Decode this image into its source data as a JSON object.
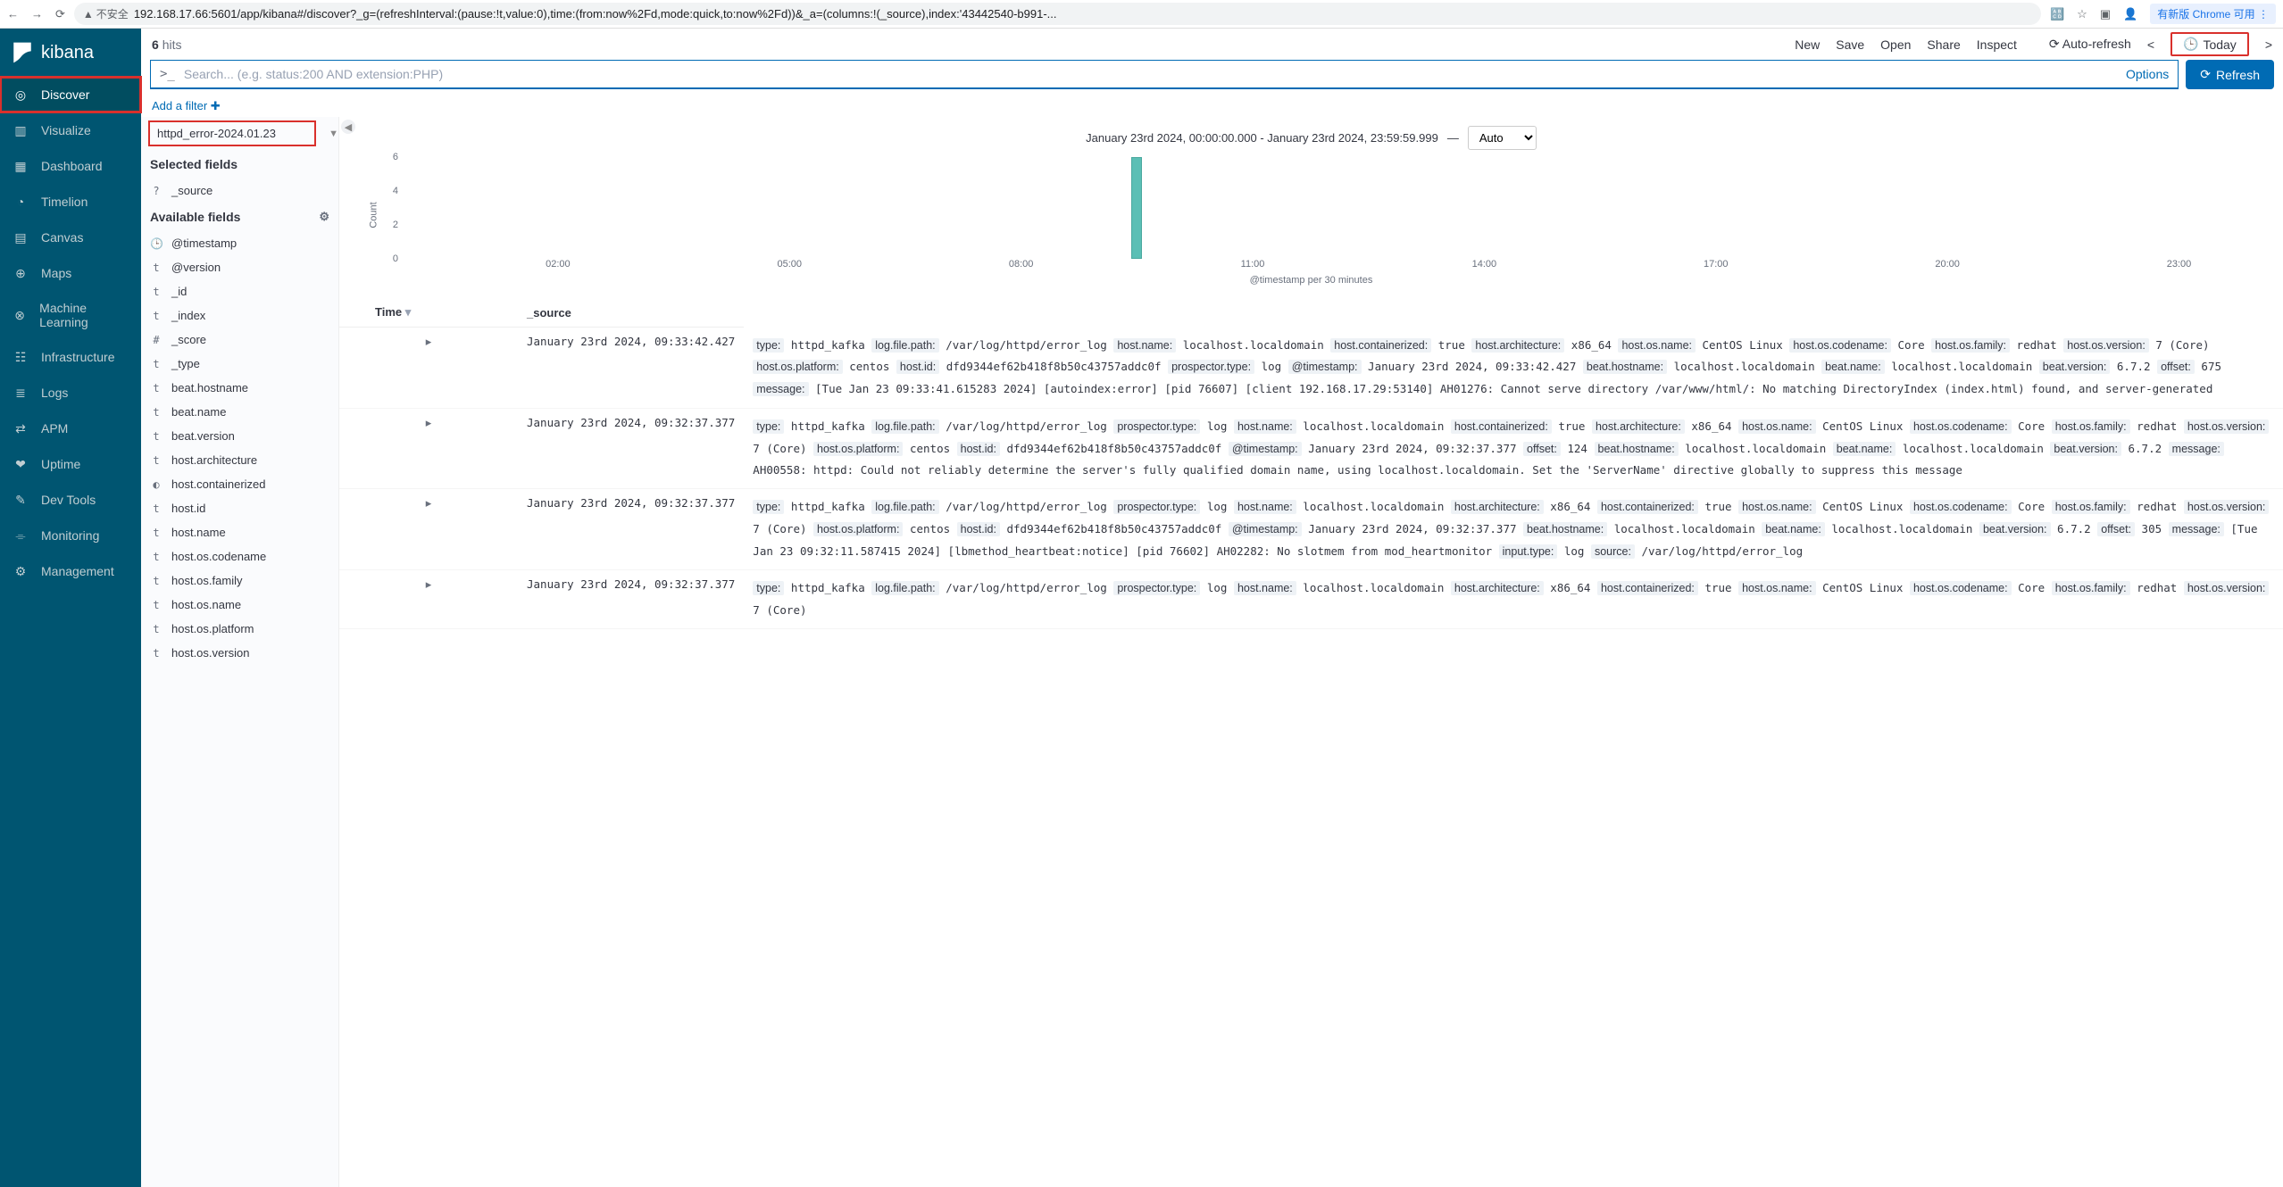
{
  "browser": {
    "secure_label": "不安全",
    "url": "192.168.17.66:5601/app/kibana#/discover?_g=(refreshInterval:(pause:!t,value:0),time:(from:now%2Fd,mode:quick,to:now%2Fd))&_a=(columns:!(_source),index:'43442540-b991-...",
    "update_badge": "有新版 Chrome 可用"
  },
  "logo": "kibana",
  "nav": [
    {
      "label": "Discover",
      "icon": "compass",
      "active": true,
      "highlight": true
    },
    {
      "label": "Visualize",
      "icon": "bars"
    },
    {
      "label": "Dashboard",
      "icon": "grid"
    },
    {
      "label": "Timelion",
      "icon": "timelion"
    },
    {
      "label": "Canvas",
      "icon": "canvas"
    },
    {
      "label": "Maps",
      "icon": "maps"
    },
    {
      "label": "Machine Learning",
      "icon": "ml"
    },
    {
      "label": "Infrastructure",
      "icon": "infra"
    },
    {
      "label": "Logs",
      "icon": "logs"
    },
    {
      "label": "APM",
      "icon": "apm"
    },
    {
      "label": "Uptime",
      "icon": "uptime"
    },
    {
      "label": "Dev Tools",
      "icon": "dev"
    },
    {
      "label": "Monitoring",
      "icon": "monitor"
    },
    {
      "label": "Management",
      "icon": "gear"
    }
  ],
  "hits_count": "6",
  "hits_label": "hits",
  "top_actions": [
    "New",
    "Save",
    "Open",
    "Share",
    "Inspect"
  ],
  "auto_refresh": "Auto-refresh",
  "time_picker": "Today",
  "search_placeholder": "Search... (e.g. status:200 AND extension:PHP)",
  "options_label": "Options",
  "refresh_label": "Refresh",
  "add_filter": "Add a filter",
  "index_pattern": "httpd_error-2024.01.23",
  "selected_fields_title": "Selected fields",
  "available_fields_title": "Available fields",
  "selected_fields": [
    {
      "type": "?",
      "name": "_source"
    }
  ],
  "available_fields": [
    {
      "type": "🕒",
      "name": "@timestamp"
    },
    {
      "type": "t",
      "name": "@version"
    },
    {
      "type": "t",
      "name": "_id"
    },
    {
      "type": "t",
      "name": "_index"
    },
    {
      "type": "#",
      "name": "_score"
    },
    {
      "type": "t",
      "name": "_type"
    },
    {
      "type": "t",
      "name": "beat.hostname"
    },
    {
      "type": "t",
      "name": "beat.name"
    },
    {
      "type": "t",
      "name": "beat.version"
    },
    {
      "type": "t",
      "name": "host.architecture"
    },
    {
      "type": "◐",
      "name": "host.containerized"
    },
    {
      "type": "t",
      "name": "host.id"
    },
    {
      "type": "t",
      "name": "host.name"
    },
    {
      "type": "t",
      "name": "host.os.codename"
    },
    {
      "type": "t",
      "name": "host.os.family"
    },
    {
      "type": "t",
      "name": "host.os.name"
    },
    {
      "type": "t",
      "name": "host.os.platform"
    },
    {
      "type": "t",
      "name": "host.os.version"
    }
  ],
  "chart_time_range": "January 23rd 2024, 00:00:00.000 - January 23rd 2024, 23:59:59.999",
  "chart_interval": "Auto",
  "chart_data": {
    "type": "bar",
    "xlabel": "@timestamp per 30 minutes",
    "ylabel": "Count",
    "ylim": [
      0,
      6
    ],
    "yticks": [
      0,
      2,
      4,
      6
    ],
    "xticks": [
      "02:00",
      "05:00",
      "08:00",
      "11:00",
      "14:00",
      "17:00",
      "20:00",
      "23:00"
    ],
    "x_range_hours": [
      0,
      24
    ],
    "bars": [
      {
        "x_hour": 9.5,
        "value": 6
      }
    ]
  },
  "table": {
    "columns": [
      "Time",
      "_source"
    ],
    "rows": [
      {
        "time": "January 23rd 2024, 09:33:42.427",
        "kv": [
          [
            "type:",
            "httpd_kafka"
          ],
          [
            "log.file.path:",
            "/var/log/httpd/error_log"
          ],
          [
            "host.name:",
            "localhost.localdomain"
          ],
          [
            "host.containerized:",
            "true"
          ],
          [
            "host.architecture:",
            "x86_64"
          ],
          [
            "host.os.name:",
            "CentOS Linux"
          ],
          [
            "host.os.codename:",
            "Core"
          ],
          [
            "host.os.family:",
            "redhat"
          ],
          [
            "host.os.version:",
            "7 (Core)"
          ],
          [
            "host.os.platform:",
            "centos"
          ],
          [
            "host.id:",
            "dfd9344ef62b418f8b50c43757addc0f"
          ],
          [
            "prospector.type:",
            "log"
          ],
          [
            "@timestamp:",
            "January 23rd 2024, 09:33:42.427"
          ],
          [
            "beat.hostname:",
            "localhost.localdomain"
          ],
          [
            "beat.name:",
            "localhost.localdomain"
          ],
          [
            "beat.version:",
            "6.7.2"
          ],
          [
            "offset:",
            "675"
          ],
          [
            "message:",
            "[Tue Jan 23 09:33:41.615283 2024] [autoindex:error] [pid 76607] [client 192.168.17.29:53140] AH01276: Cannot serve directory /var/www/html/: No matching DirectoryIndex (index.html) found, and server-generated"
          ]
        ]
      },
      {
        "time": "January 23rd 2024, 09:32:37.377",
        "kv": [
          [
            "type:",
            "httpd_kafka"
          ],
          [
            "log.file.path:",
            "/var/log/httpd/error_log"
          ],
          [
            "prospector.type:",
            "log"
          ],
          [
            "host.name:",
            "localhost.localdomain"
          ],
          [
            "host.containerized:",
            "true"
          ],
          [
            "host.architecture:",
            "x86_64"
          ],
          [
            "host.os.name:",
            "CentOS Linux"
          ],
          [
            "host.os.codename:",
            "Core"
          ],
          [
            "host.os.family:",
            "redhat"
          ],
          [
            "host.os.version:",
            "7 (Core)"
          ],
          [
            "host.os.platform:",
            "centos"
          ],
          [
            "host.id:",
            "dfd9344ef62b418f8b50c43757addc0f"
          ],
          [
            "@timestamp:",
            "January 23rd 2024, 09:32:37.377"
          ],
          [
            "offset:",
            "124"
          ],
          [
            "beat.hostname:",
            "localhost.localdomain"
          ],
          [
            "beat.name:",
            "localhost.localdomain"
          ],
          [
            "beat.version:",
            "6.7.2"
          ],
          [
            "message:",
            "AH00558: httpd: Could not reliably determine the server's fully qualified domain name, using localhost.localdomain. Set the 'ServerName' directive globally to suppress this message"
          ]
        ]
      },
      {
        "time": "January 23rd 2024, 09:32:37.377",
        "kv": [
          [
            "type:",
            "httpd_kafka"
          ],
          [
            "log.file.path:",
            "/var/log/httpd/error_log"
          ],
          [
            "prospector.type:",
            "log"
          ],
          [
            "host.name:",
            "localhost.localdomain"
          ],
          [
            "host.architecture:",
            "x86_64"
          ],
          [
            "host.containerized:",
            "true"
          ],
          [
            "host.os.name:",
            "CentOS Linux"
          ],
          [
            "host.os.codename:",
            "Core"
          ],
          [
            "host.os.family:",
            "redhat"
          ],
          [
            "host.os.version:",
            "7 (Core)"
          ],
          [
            "host.os.platform:",
            "centos"
          ],
          [
            "host.id:",
            "dfd9344ef62b418f8b50c43757addc0f"
          ],
          [
            "@timestamp:",
            "January 23rd 2024, 09:32:37.377"
          ],
          [
            "beat.hostname:",
            "localhost.localdomain"
          ],
          [
            "beat.name:",
            "localhost.localdomain"
          ],
          [
            "beat.version:",
            "6.7.2"
          ],
          [
            "offset:",
            "305"
          ],
          [
            "message:",
            "[Tue Jan 23 09:32:11.587415 2024] [lbmethod_heartbeat:notice] [pid 76602] AH02282: No slotmem from mod_heartmonitor"
          ],
          [
            "input.type:",
            "log"
          ],
          [
            "source:",
            "/var/log/httpd/error_log"
          ]
        ]
      },
      {
        "time": "January 23rd 2024, 09:32:37.377",
        "kv": [
          [
            "type:",
            "httpd_kafka"
          ],
          [
            "log.file.path:",
            "/var/log/httpd/error_log"
          ],
          [
            "prospector.type:",
            "log"
          ],
          [
            "host.name:",
            "localhost.localdomain"
          ],
          [
            "host.architecture:",
            "x86_64"
          ],
          [
            "host.containerized:",
            "true"
          ],
          [
            "host.os.name:",
            "CentOS Linux"
          ],
          [
            "host.os.codename:",
            "Core"
          ],
          [
            "host.os.family:",
            "redhat"
          ],
          [
            "host.os.version:",
            "7 (Core)"
          ]
        ]
      }
    ]
  }
}
